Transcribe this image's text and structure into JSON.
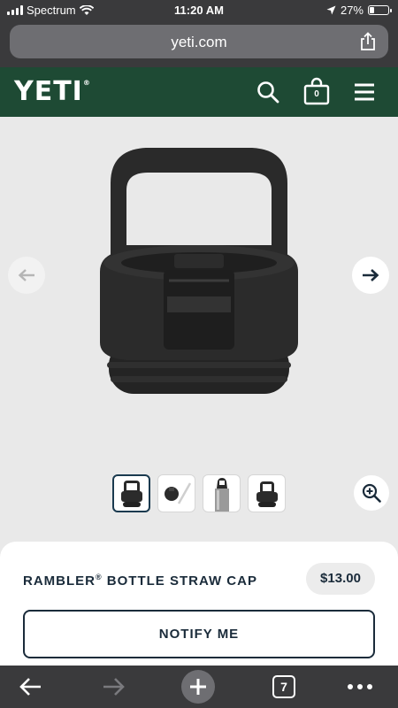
{
  "status_bar": {
    "carrier": "Spectrum",
    "time": "11:20 AM",
    "battery": "27%",
    "battery_level": 0.27
  },
  "browser": {
    "url": "yeti.com",
    "tab_count": "7"
  },
  "site": {
    "logo": "YETI",
    "cart_count": "0"
  },
  "gallery": {
    "thumbnails": [
      {
        "name": "cap-front",
        "active": true
      },
      {
        "name": "cap-with-straw",
        "active": false
      },
      {
        "name": "cap-on-bottle",
        "active": false
      },
      {
        "name": "cap-angle",
        "active": false
      }
    ]
  },
  "product": {
    "name": "RAMBLER",
    "name_mark": "®",
    "name_rest": " BOTTLE STRAW CAP",
    "price": "$13.00",
    "cta_label": "NOTIFY ME"
  },
  "colors": {
    "header_green": "#1e4a34",
    "navy": "#1a2b3a",
    "browser_chrome": "#3a3a3c"
  },
  "icons": [
    "wifi-icon",
    "location-icon",
    "share-icon",
    "search-icon",
    "cart-icon",
    "menu-icon",
    "arrow-left-icon",
    "arrow-right-icon",
    "zoom-in-icon",
    "back-icon",
    "forward-icon",
    "plus-icon",
    "tabs-icon",
    "more-icon"
  ]
}
